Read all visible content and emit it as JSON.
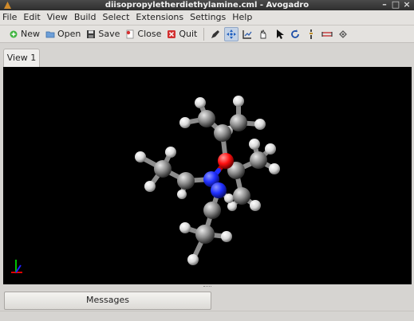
{
  "window": {
    "title": "diisopropyletherdiethylamine.cml - Avogadro",
    "minimize": "–",
    "maximize": "□",
    "close": "×"
  },
  "menu": {
    "items": [
      "File",
      "Edit",
      "View",
      "Build",
      "Select",
      "Extensions",
      "Settings",
      "Help"
    ]
  },
  "toolbar": {
    "new_label": "New",
    "open_label": "Open",
    "save_label": "Save",
    "close_label": "Close",
    "quit_label": "Quit",
    "tools": [
      "draw-tool-icon",
      "navigate-tool-icon",
      "bond-centric-tool-icon",
      "manipulate-tool-icon",
      "select-tool-icon",
      "auto-rotate-tool-icon",
      "auto-optimize-tool-icon",
      "measure-tool-icon",
      "align-tool-icon"
    ],
    "active_tool": "navigate-tool-icon"
  },
  "tabs": {
    "view1": "View 1"
  },
  "viewport": {
    "background": "#000000",
    "colors": {
      "carbon": "#9a9a9a",
      "hydrogen": "#eeeeee",
      "nitrogen": "#1f2fff",
      "oxygen": "#ff1010"
    },
    "axes": {
      "x_color": "#e00000",
      "y_color": "#00c000",
      "z_color": "#2020ff"
    }
  },
  "bottom": {
    "messages_label": "Messages"
  }
}
